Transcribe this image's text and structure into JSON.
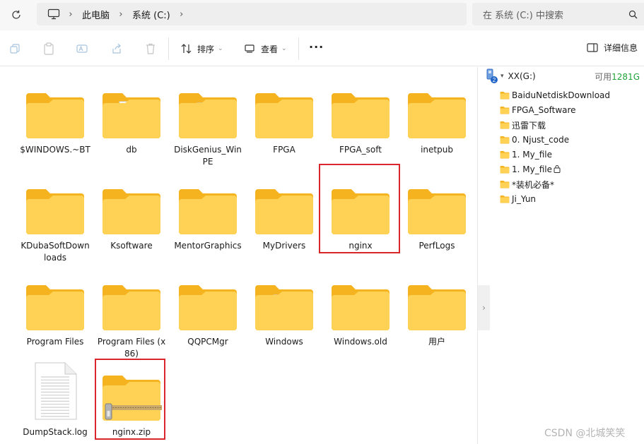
{
  "address_bar": {
    "breadcrumb": [
      "此电脑",
      "系统 (C:)"
    ],
    "search_placeholder": "在 系统 (C:) 中搜索"
  },
  "toolbar": {
    "sort_label": "排序",
    "view_label": "查看",
    "more_label": "···",
    "details_label": "详细信息"
  },
  "items": [
    {
      "name": "$WINDOWS.~BT",
      "type": "folder"
    },
    {
      "name": "db",
      "type": "folder-doc-gear"
    },
    {
      "name": "DiskGenius_WinPE",
      "type": "folder-doc"
    },
    {
      "name": "FPGA",
      "type": "folder"
    },
    {
      "name": "FPGA_soft",
      "type": "folder"
    },
    {
      "name": "inetpub",
      "type": "folder"
    },
    {
      "name": "KDubaSoftDownloads",
      "type": "folder"
    },
    {
      "name": "Ksoftware",
      "type": "folder"
    },
    {
      "name": "MentorGraphics",
      "type": "folder"
    },
    {
      "name": "MyDrivers",
      "type": "folder"
    },
    {
      "name": "nginx",
      "type": "folder",
      "highlighted": true
    },
    {
      "name": "PerfLogs",
      "type": "folder"
    },
    {
      "name": "Program Files",
      "type": "folder"
    },
    {
      "name": "Program Files (x86)",
      "type": "folder"
    },
    {
      "name": "QQPCMgr",
      "type": "folder"
    },
    {
      "name": "Windows",
      "type": "folder-doc"
    },
    {
      "name": "Windows.old",
      "type": "folder"
    },
    {
      "name": "用户",
      "type": "folder"
    },
    {
      "name": "DumpStack.log",
      "type": "text-file"
    },
    {
      "name": "nginx.zip",
      "type": "zip-folder",
      "highlighted": true
    }
  ],
  "details_pane": {
    "drive_name": "XX(G:)",
    "drive_badge": "2",
    "free_prefix": "可用",
    "free_value": "1281G",
    "tree": [
      {
        "name": "BaiduNetdiskDownload"
      },
      {
        "name": "FPGA_Software"
      },
      {
        "name": "迅雷下载"
      },
      {
        "name": "0. Njust_code"
      },
      {
        "name": "1. My_file"
      },
      {
        "name": "1. My_file",
        "locked": true
      },
      {
        "name": "*装机必备*"
      },
      {
        "name": "Ji_Yun"
      }
    ]
  },
  "watermark": "CSDN @北城笑笑",
  "colors": {
    "folder_back": "#f5b41f",
    "folder_front": "#ffd154",
    "highlight": "#d9262a",
    "free_space": "#21a33a"
  }
}
